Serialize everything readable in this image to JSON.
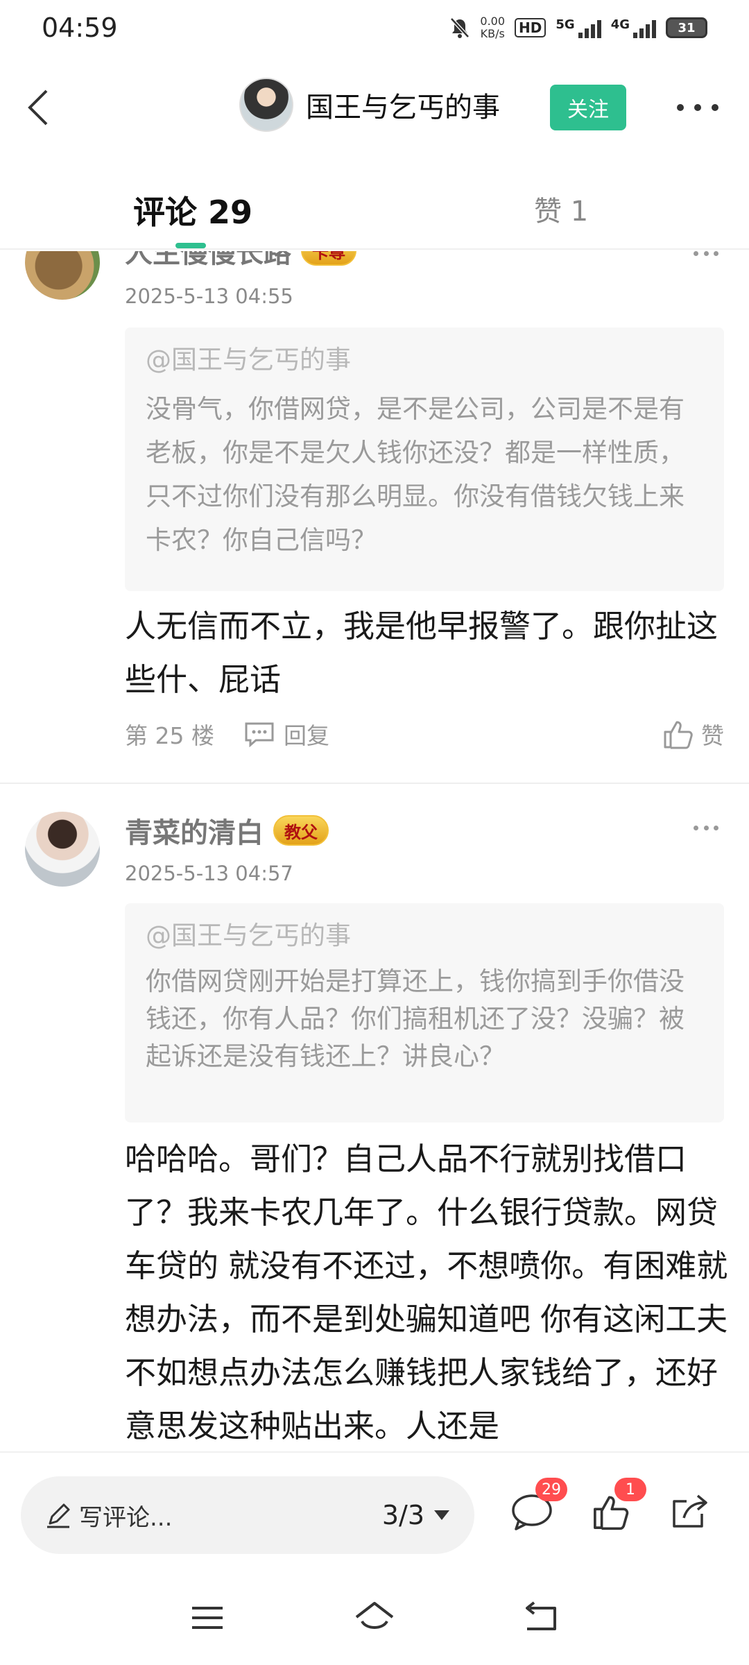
{
  "status_bar": {
    "time": "04:59",
    "net_speed_value": "0.00",
    "net_speed_unit": "KB/s",
    "hd_label": "HD",
    "sig1_label": "5G",
    "sig2_label": "4G",
    "battery": "31"
  },
  "header": {
    "title": "国王与乞丐的事",
    "follow_label": "关注"
  },
  "tabs": {
    "comments_label": "评论 29",
    "likes_label": "赞 1"
  },
  "comments": [
    {
      "name": "人生慢慢长路",
      "badge": "卡尊",
      "time": "2025-5-13 04:55",
      "quote_ref": "@国王与乞丐的事",
      "quote_text": "没骨气，你借网贷，是不是公司，公司是不是有老板，你是不是欠人钱你还没？都是一样性质，只不过你们没有那么明显。你没有借钱欠钱上来卡农？你自己信吗？",
      "body": "人无信而不立，我是他早报警了。跟你扯这些什、屁话",
      "floor": "第 25 楼",
      "reply_label": "回复",
      "like_label": "赞"
    },
    {
      "name": "青菜的清白",
      "badge": "教父",
      "time": "2025-5-13 04:57",
      "quote_ref": "@国王与乞丐的事",
      "quote_text": "你借网贷刚开始是打算还上，钱你搞到手你借没钱还，你有人品？你们搞租机还了没？没骗？被起诉还是没有钱还上？讲良心？",
      "body": "哈哈哈。哥们？自己人品不行就别找借口了？我来卡农几年了。什么银行贷款。网贷车贷的 就没有不还过，不想喷你。有困难就想办法，而不是到处骗知道吧 你有这闲工夫不如想点办法怎么赚钱把人家钱给了，还好意思发这种贴出来。人还是"
    }
  ],
  "bottom_bar": {
    "write_placeholder": "写评论...",
    "page_indicator": "3/3",
    "comment_count": "29",
    "like_count": "1"
  },
  "colors": {
    "accent": "#2ebf8f",
    "badge_red": "#ff4d4f"
  }
}
